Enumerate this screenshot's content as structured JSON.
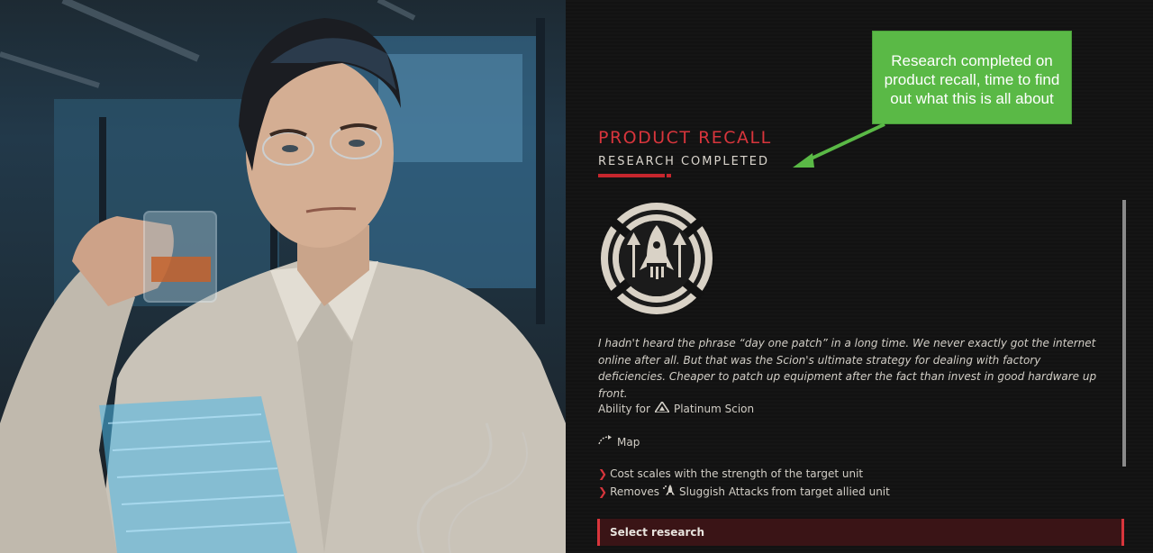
{
  "research": {
    "title": "PRODUCT RECALL",
    "status": "RESEARCH COMPLETED",
    "flavor_text": "I hadn't heard the phrase “day one patch” in a long time. We never exactly got the internet online after all. But that was the Scion's ultimate strategy for dealing with factory deficiencies. Cheaper to patch up equipment after the fact than invest in good hardware up front.",
    "ability_prefix": "Ability for",
    "ability_unit": "Platinum Scion",
    "scope": "Map",
    "effects": [
      "Cost scales with the strength of the target unit",
      "Removes"
    ],
    "effect2_keyword": "Sluggish Attacks",
    "effect2_suffix": "from target allied unit",
    "select_label": "Select research",
    "emblem_icon": "rocket-arrows-emblem-icon"
  },
  "annotation": {
    "text": "Research completed on product recall, time to find out what this is all about"
  },
  "colors": {
    "accent_red": "#d8353c",
    "callout_green": "#5ab946",
    "panel_bg": "#121212",
    "text_light": "#d2cec6"
  }
}
